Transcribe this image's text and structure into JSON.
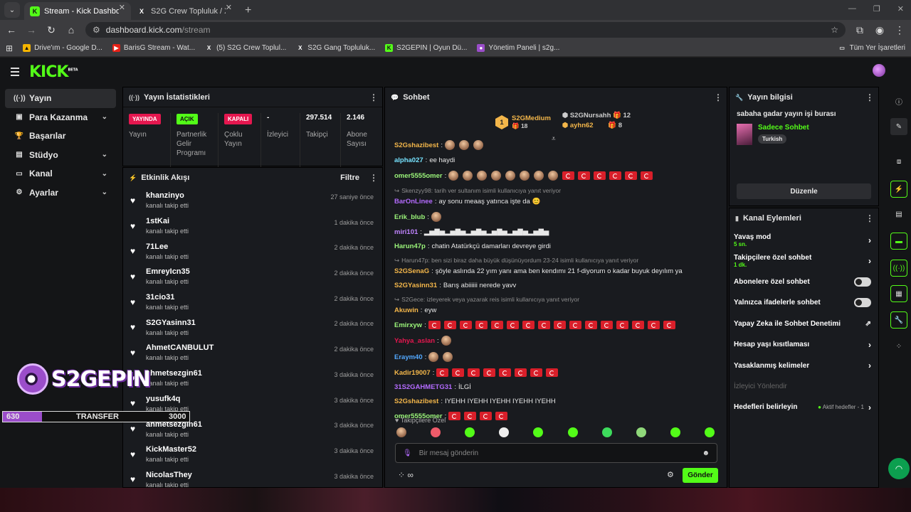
{
  "browser": {
    "tabs": [
      {
        "title": "Stream - Kick Dashboard",
        "active": true
      },
      {
        "title": "S2G Crew Topluluk / X",
        "active": false
      }
    ],
    "url_host": "dashboard.kick.com",
    "url_path": "/stream",
    "bookmarks": [
      "Drive'ım - Google D...",
      "BarisG Stream - Wat...",
      "(5) S2G Crew Toplul...",
      "S2G Gang Topluluk...",
      "S2GEPIN | Oyun Dü...",
      "Yönetim Paneli | s2g..."
    ],
    "all_bookmarks": "Tüm Yer İşaretleri"
  },
  "sidebar": {
    "items": [
      {
        "label": "Yayın",
        "icon": "broadcast-icon"
      },
      {
        "label": "Para Kazanma",
        "icon": "money-icon"
      },
      {
        "label": "Başarılar",
        "icon": "trophy-icon"
      },
      {
        "label": "Stüdyo",
        "icon": "studio-icon"
      },
      {
        "label": "Kanal",
        "icon": "channel-icon"
      },
      {
        "label": "Ayarlar",
        "icon": "gear-icon"
      }
    ]
  },
  "stats": {
    "title": "Yayın İstatistikleri",
    "items": [
      {
        "badge": "YAYINDA",
        "badge_color": "#e5174f",
        "label": "Yayın"
      },
      {
        "badge": "AÇIK",
        "badge_color": "#53fc18",
        "label": "Partnerlik Gelir Programı"
      },
      {
        "badge": "KAPALI",
        "badge_color": "#e5174f",
        "label": "Çoklu Yayın"
      },
      {
        "value": "-",
        "label": "İzleyici"
      },
      {
        "value": "297.514",
        "label": "Takipçi"
      },
      {
        "value": "2.146",
        "label": "Abone Sayısı"
      }
    ]
  },
  "activity": {
    "title": "Etkinlik Akışı",
    "filter": "Filtre",
    "events": [
      {
        "user": "khanzinyo",
        "action": "kanalı takip etti",
        "time": "27 saniye önce"
      },
      {
        "user": "1stKai",
        "action": "kanalı takip etti",
        "time": "1 dakika önce"
      },
      {
        "user": "71Lee",
        "action": "kanalı takip etti",
        "time": "2 dakika önce"
      },
      {
        "user": "EmreyIcn35",
        "action": "kanalı takip etti",
        "time": "2 dakika önce"
      },
      {
        "user": "31cio31",
        "action": "kanalı takip etti",
        "time": "2 dakika önce"
      },
      {
        "user": "S2GYasinn31",
        "action": "kanalı takip etti",
        "time": "2 dakika önce"
      },
      {
        "user": "AhmetCANBULUT",
        "action": "kanalı takip etti",
        "time": "2 dakika önce"
      },
      {
        "user": "ahmetsezgin61",
        "action": "kanalı takip etti",
        "time": "3 dakika önce"
      },
      {
        "user": "yusufk4q",
        "action": "kanalı takip etti",
        "time": "3 dakika önce"
      },
      {
        "user": "ahmetsezgin61",
        "action": "kanalı takip etti",
        "time": "3 dakika önce"
      },
      {
        "user": "KickMaster52",
        "action": "kanalı takip etti",
        "time": "3 dakika önce"
      },
      {
        "user": "NicolasThey",
        "action": "kanalı takip etti",
        "time": "3 dakika önce"
      }
    ]
  },
  "chat": {
    "title": "Sohbet",
    "top_gifters": [
      {
        "name": "S2GMedium",
        "count": "18",
        "rank": "1"
      },
      {
        "name": "S2GNursahh",
        "count": "12"
      },
      {
        "name": "ayhn62",
        "count": "8"
      }
    ],
    "messages": [
      {
        "user": "S2Gshazibest",
        "color": "#f3b64a",
        "text": "",
        "emotes": 3
      },
      {
        "user": "alpha027",
        "color": "#76e3ff",
        "text": "ee haydi"
      },
      {
        "user": "omer5555omer",
        "color": "#9bf57a",
        "text": "",
        "emotes": 8,
        "flags": 6
      },
      {
        "reply": "Skenzyy98: tarih ver sultanım isimli kullanıcıya yanıt veriyor"
      },
      {
        "user": "BarOnLinee",
        "color": "#b46bff",
        "text": "ay sonu meaaş yatınca işte da 😊"
      },
      {
        "user": "Erik_blub",
        "color": "#9bf57a",
        "text": "",
        "emotes": 1
      },
      {
        "user": "miri101",
        "color": "#c084ff",
        "text": "▂▅▇▅▂▅▇▅▂▅▇▅▂▅▇▅▂▅▇▅▂▅▇▅"
      },
      {
        "user": "Harun47p",
        "color": "#9bf57a",
        "text": "chatin Atatürkçü damarları devreye girdi"
      },
      {
        "reply": "Harun47p: ben sizi biraz daha büyük düşünüyordum 23-24 isimli kullanıcıya yanıt veriyor"
      },
      {
        "user": "S2GSenaG",
        "color": "#f3b64a",
        "text": "şöyle aslında 22 yım yanı ama ben kendımı 21 f-diyorum o kadar buyuk deyılım ya"
      },
      {
        "user": "S2GYasinn31",
        "color": "#f3b64a",
        "text": "Barış abiiiiii nerede yavv"
      },
      {
        "reply": "S2Gece: izleyerek veya yazarak reis isimli kullanıcıya yanıt veriyor"
      },
      {
        "user": "Akuwin",
        "color": "#f3b64a",
        "text": "eyw"
      },
      {
        "user": "Emirxyw",
        "color": "#9bf57a",
        "text": "",
        "flags": 16
      },
      {
        "user": "Yahya_aslan",
        "color": "#e5174f",
        "text": "",
        "emotes": 1
      },
      {
        "user": "Eraym40",
        "color": "#52a8ff",
        "text": "",
        "emotes": 2
      },
      {
        "user": "Kadir19007",
        "color": "#f3b64a",
        "text": "",
        "flags": 8
      },
      {
        "user": "31S2GAHMETG31",
        "color": "#b46bff",
        "text": "İLGİ"
      },
      {
        "user": "S2Gshazibest",
        "color": "#f3b64a",
        "text": "IYEHH IYEHH IYEHH IYEHH IYEHH"
      },
      {
        "user": "omer5555omer",
        "color": "#9bf57a",
        "text": "",
        "flags": 4
      }
    ],
    "followers_only": "Takipçilere Özel",
    "input_placeholder": "Bir mesaj gönderin",
    "send": "Gönder"
  },
  "stream_info": {
    "title": "Yayın bilgisi",
    "stream_title": "sabaha gadar yayın işi burası",
    "category": "Sadece Sohbet",
    "tag": "Turkish",
    "edit": "Düzenle"
  },
  "channel_actions": {
    "title": "Kanal Eylemleri",
    "items": [
      {
        "label": "Yavaş mod",
        "sub": "5 sn.",
        "type": "chevron"
      },
      {
        "label": "Takipçilere özel sohbet",
        "sub": "1 dk.",
        "type": "chevron"
      },
      {
        "label": "Abonelere özel sohbet",
        "type": "toggle"
      },
      {
        "label": "Yalnızca ifadelerle sohbet",
        "type": "toggle"
      },
      {
        "label": "Yapay Zeka ile Sohbet Denetimi",
        "type": "external"
      },
      {
        "label": "Hesap yaşı kısıtlaması",
        "type": "chevron"
      },
      {
        "label": "Yasaklanmış kelimeler",
        "type": "chevron"
      },
      {
        "label": "İzleyici Yönlendir",
        "type": "disabled"
      },
      {
        "label": "Hedefleri belirleyin",
        "type": "chevron",
        "extra": "Aktif hedefler - 1"
      }
    ]
  },
  "overlay": {
    "brand": "S2GEPIN",
    "left_value": "630",
    "middle": "TRANSFER",
    "right_value": "3000"
  }
}
